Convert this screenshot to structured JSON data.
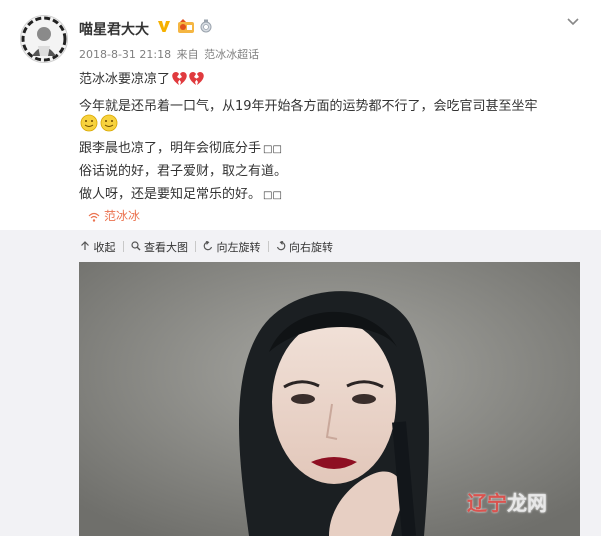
{
  "post": {
    "author": "喵星君大大",
    "time": "2018-8-31 21:18",
    "source_prefix": "来自",
    "source": "范冰冰超话",
    "text_line1": "范冰冰要凉凉了",
    "text_line2": "今年就是还吊着一口气，从19年开始各方面的运势都不行了，会吃官司甚至坐牢",
    "text_line4": "跟李晨也凉了，明年会彻底分手",
    "text_line5": "俗话说的好，君子爱财，取之有道。",
    "text_line6": "做人呀，还是要知足常乐的好。",
    "topic": "范冰冰",
    "badge_icons": [
      "verified-v-icon",
      "level-badge-icon",
      "medal-icon"
    ]
  },
  "toolbar": {
    "collapse": "收起",
    "view_large": "查看大图",
    "rotate_left": "向左旋转",
    "rotate_right": "向右旋转"
  },
  "watermark": {
    "red_part": "辽宁",
    "white_part": "龙网"
  },
  "colors": {
    "topic": "#eb7350",
    "meta": "#808080",
    "text": "#333333",
    "feed_bg": "#f2f2f5"
  }
}
